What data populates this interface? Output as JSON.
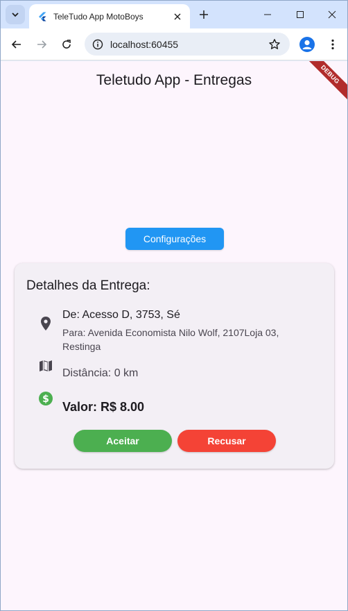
{
  "browser": {
    "tab_title": "TeleTudo App MotoBoys",
    "url": "localhost:60455",
    "icons": {
      "tab_search": "chevron-down-icon",
      "favicon": "flutter-icon",
      "close": "close-icon",
      "new_tab": "plus-icon",
      "minimize": "minimize-icon",
      "maximize": "maximize-icon",
      "window_close": "close-icon",
      "back": "arrow-left-icon",
      "forward": "arrow-right-icon",
      "reload": "reload-icon",
      "site_info": "info-icon",
      "bookmark": "star-icon",
      "profile": "person-icon",
      "menu": "more-vert-icon"
    }
  },
  "app": {
    "title": "Teletudo App - Entregas",
    "debug_banner": "DEBUG",
    "config_button": "Configurações",
    "colors": {
      "primary": "#2196f3",
      "accept": "#4caf50",
      "decline": "#f44336",
      "money": "#4caf50"
    }
  },
  "delivery": {
    "heading": "Detalhes da Entrega:",
    "from": "De: Acesso D, 3753, Sé",
    "to": "Para: Avenida Economista Nilo Wolf, 2107Loja 03, Restinga",
    "distance": "Distância: 0 km",
    "value": "Valor: R$ 8.00",
    "accept_label": "Aceitar",
    "decline_label": "Recusar",
    "icons": {
      "location": "location-pin-icon",
      "map": "map-icon",
      "money": "dollar-icon"
    }
  }
}
